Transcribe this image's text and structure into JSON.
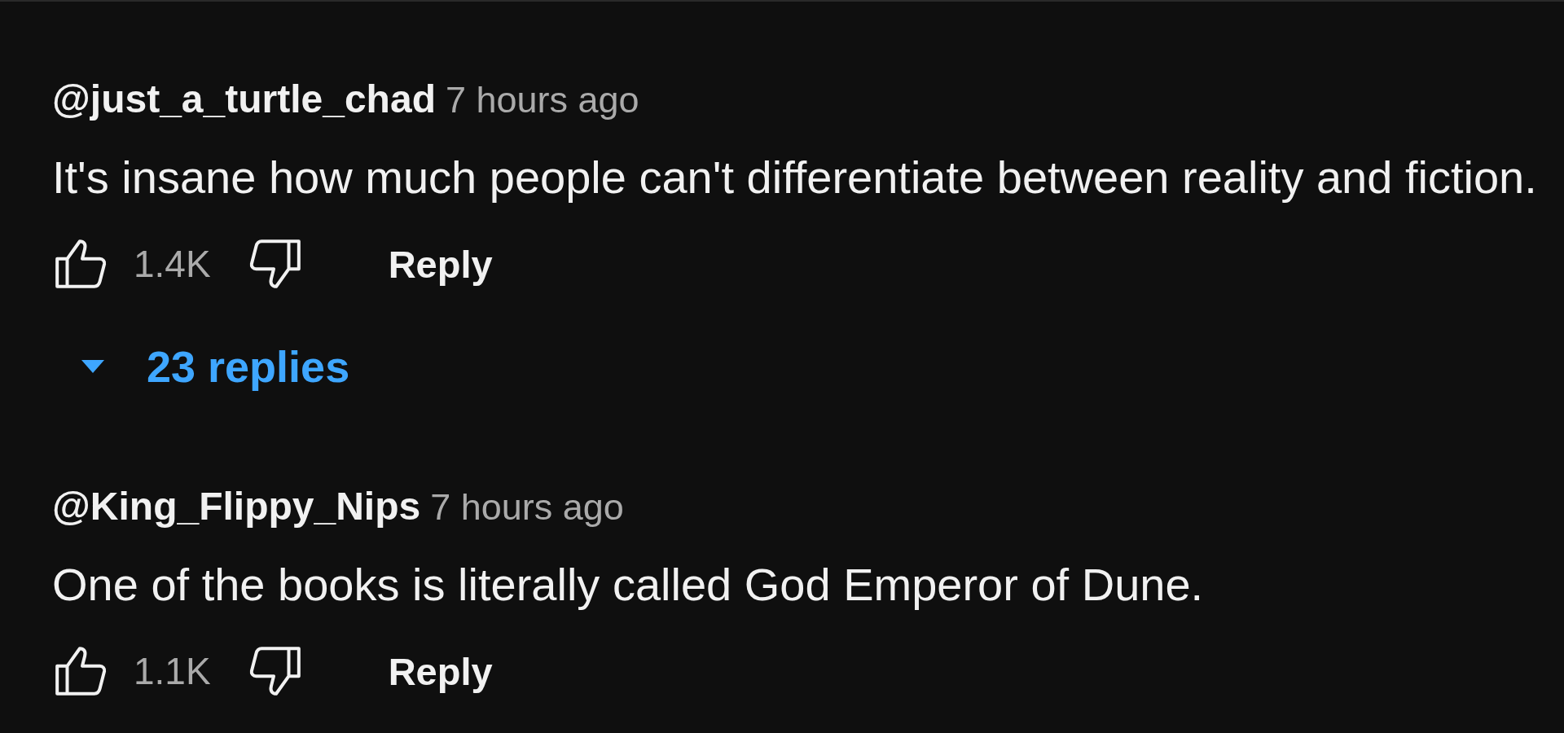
{
  "comments": [
    {
      "author": "@just_a_turtle_chad",
      "time": "7 hours ago",
      "text": "It's insane how much people can't differentiate between reality and fiction.",
      "likes": "1.4K",
      "reply_button": "Reply",
      "replies": {
        "label": "23 replies",
        "expanded": false
      }
    },
    {
      "author": "@King_Flippy_Nips",
      "time": "7 hours ago",
      "text": "One of the books is literally called God Emperor of Dune.",
      "likes": "1.1K",
      "reply_button": "Reply"
    }
  ]
}
